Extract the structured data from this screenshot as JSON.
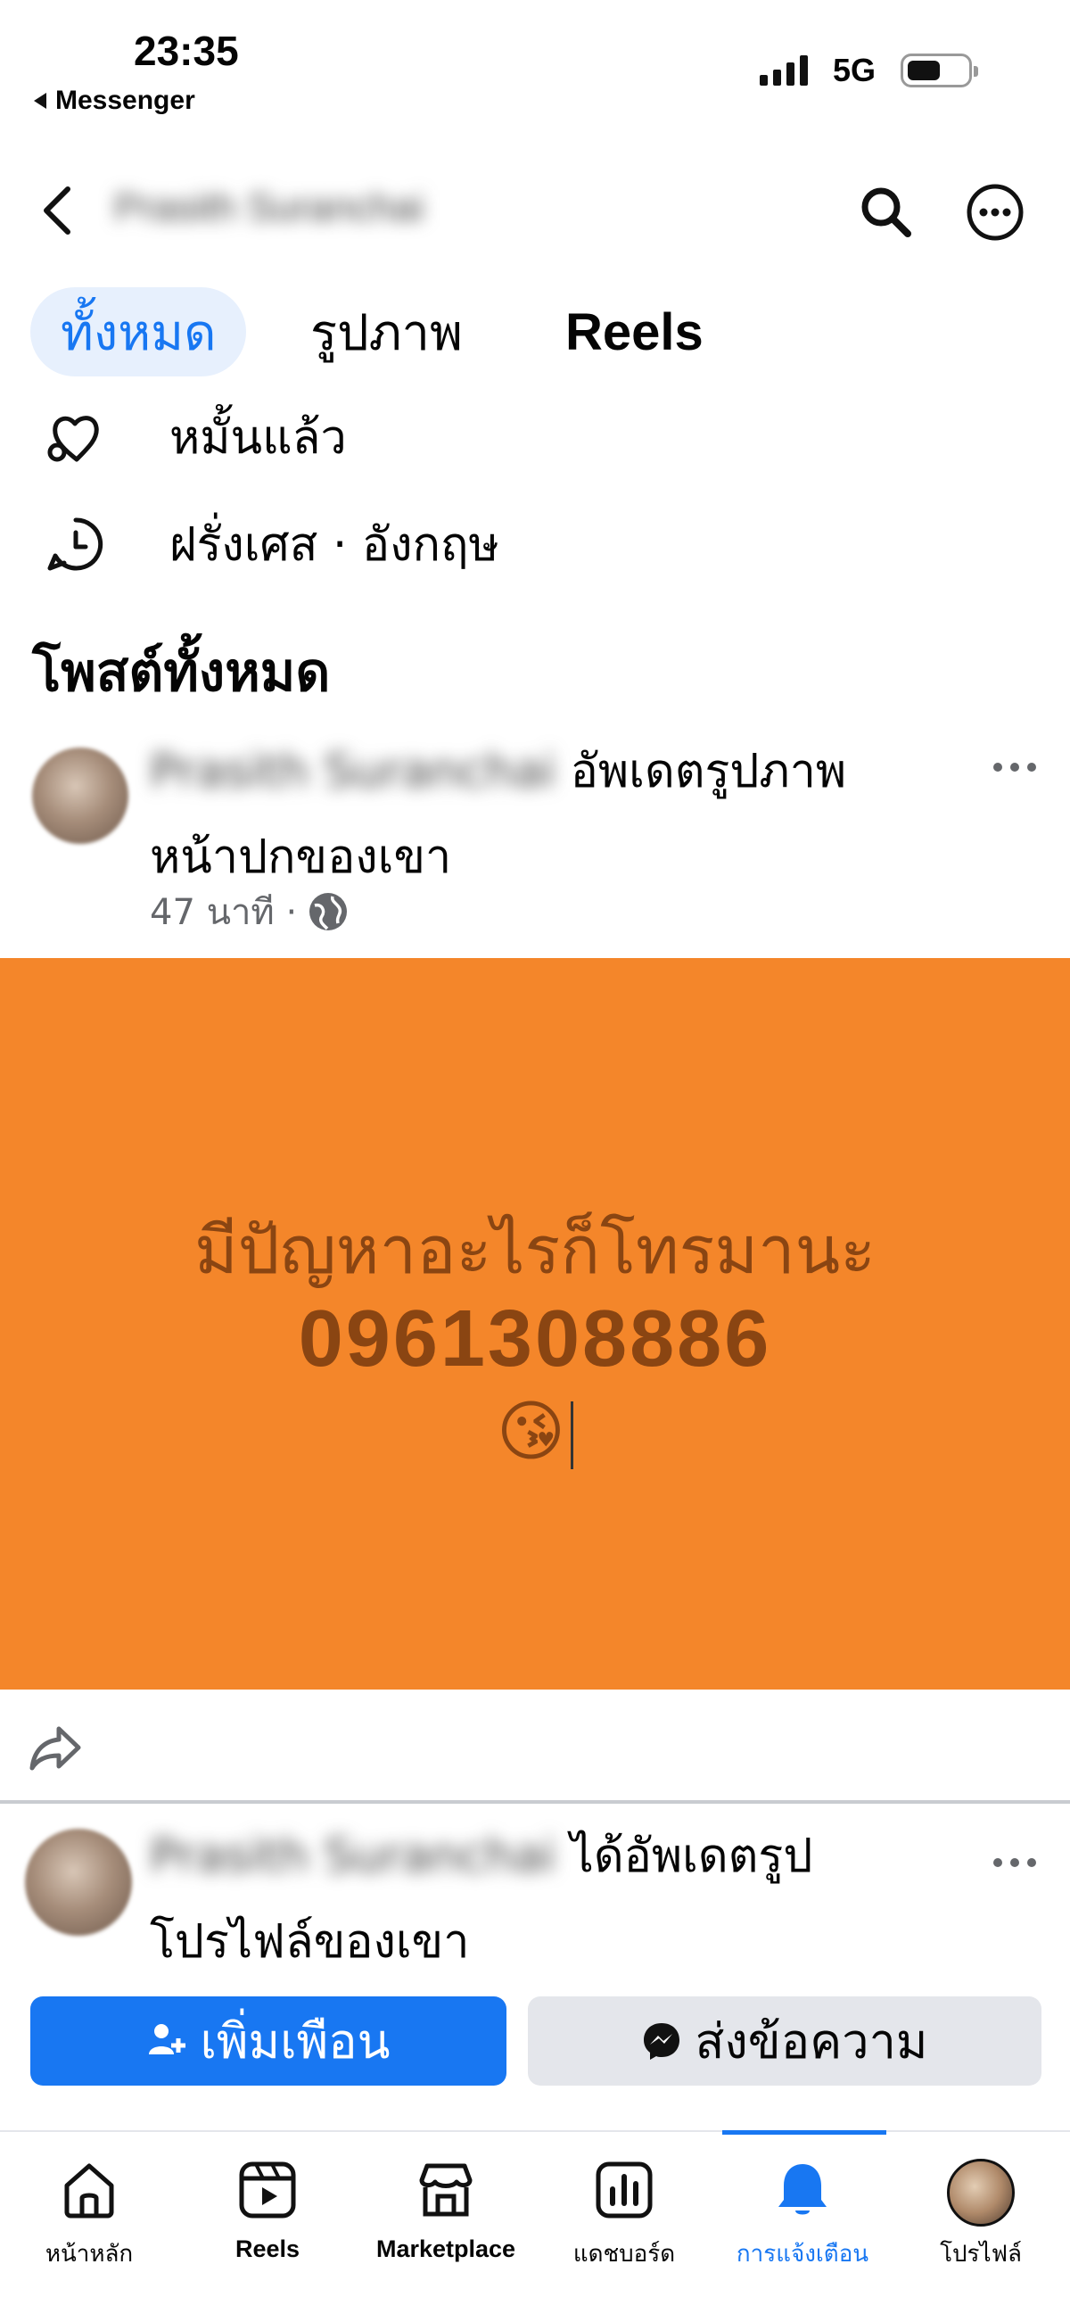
{
  "status_bar": {
    "time": "23:35",
    "back_app": "Messenger",
    "network": "5G"
  },
  "header": {
    "profile_name": "Prasith Suranchai",
    "icons": [
      "back-arrow-icon",
      "search-icon",
      "more-options-icon"
    ]
  },
  "tabs": [
    {
      "label": "ทั้งหมด",
      "active": true
    },
    {
      "label": "รูปภาพ",
      "active": false
    },
    {
      "label": "Reels",
      "active": false
    }
  ],
  "info": {
    "relationship": "หมั้นแล้ว",
    "languages": "ฝรั่งเศส · อังกฤษ"
  },
  "section_title": "โพสต์ทั้งหมด",
  "posts": [
    {
      "author": "Prasith Suranchai",
      "action_line1": "อัพเดตรูปภาพ",
      "action_line2": "หน้าปกของเขา",
      "time": "47 นาที ·",
      "image": {
        "background": "#f4862a",
        "line1": "มีปัญหาอะไรก็โทรมานะ",
        "line2": "0961308886",
        "emoji": "😘"
      }
    },
    {
      "author": "Prasith Suranchai",
      "action_line1": "ได้อัพเดตรูป",
      "action_line2": "โปรไฟล์ของเขา"
    }
  ],
  "actions": {
    "add_friend": "เพิ่มเพือน",
    "message": "ส่งข้อความ"
  },
  "bottom_nav": [
    {
      "label": "หน้าหลัก",
      "icon": "home-icon",
      "active": false
    },
    {
      "label": "Reels",
      "icon": "reels-icon",
      "active": false
    },
    {
      "label": "Marketplace",
      "icon": "marketplace-icon",
      "active": false
    },
    {
      "label": "แดชบอร์ด",
      "icon": "dashboard-icon",
      "active": false
    },
    {
      "label": "การแจ้งเตือน",
      "icon": "bell-icon",
      "active": true
    },
    {
      "label": "โปรไฟล์",
      "icon": "profile-avatar",
      "active": false
    }
  ],
  "colors": {
    "accent": "#1877f2",
    "orange_post": "#f4862a",
    "orange_text": "#8a4512"
  }
}
